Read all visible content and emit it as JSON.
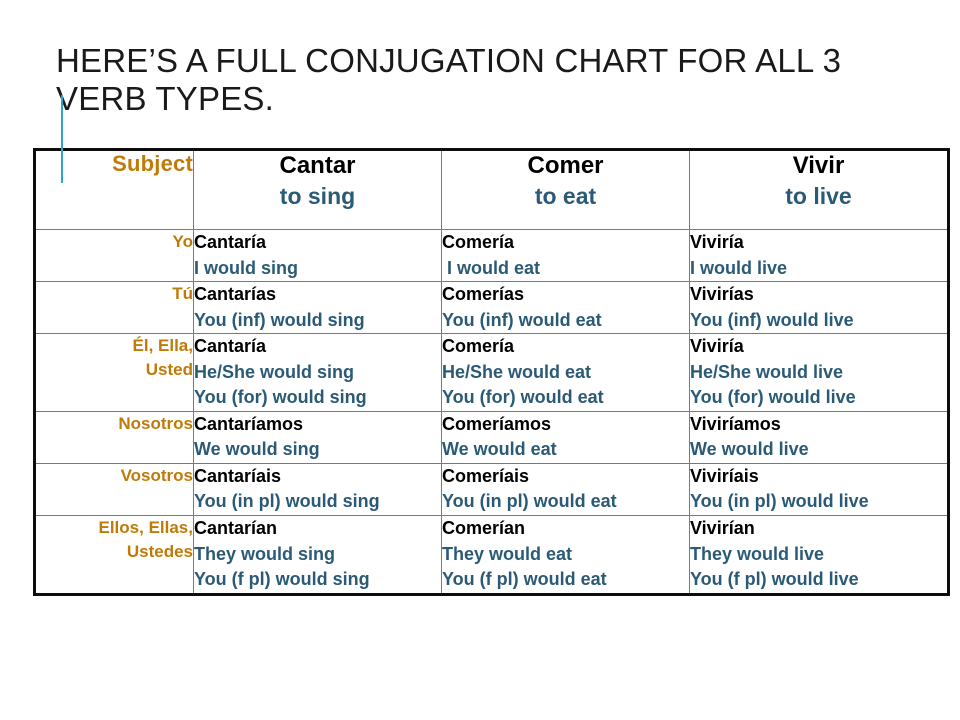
{
  "slide": {
    "title": "HERE’S A FULL CONJUGATION CHART FOR ALL 3 VERB TYPES.",
    "accent_line_color": "#2CA6CB",
    "subject_color": "#C07A08",
    "verb_color": "#000000",
    "translation_color": "#2B5A77",
    "table_border_color": "#0D0D0D",
    "grid_line_color": "#7A7A7A"
  },
  "table": {
    "headers": {
      "subject": "Subject",
      "columns": [
        {
          "verb": "Cantar",
          "gloss": "to sing"
        },
        {
          "verb": "Comer",
          "gloss": "to eat"
        },
        {
          "verb": "Vivir",
          "gloss": "to live"
        }
      ]
    },
    "rows": [
      {
        "subject_lines": [
          "Yo"
        ],
        "cells": [
          {
            "form": "Cantaría",
            "translations": [
              "I would sing"
            ]
          },
          {
            "form": "Comería",
            "translations": [
              " I would eat"
            ]
          },
          {
            "form": "Viviría",
            "translations": [
              "I would live"
            ]
          }
        ]
      },
      {
        "subject_lines": [
          "Tú"
        ],
        "cells": [
          {
            "form": "Cantarías",
            "translations": [
              "You (inf) would sing"
            ]
          },
          {
            "form": "Comerías",
            "translations": [
              "You (inf) would eat"
            ]
          },
          {
            "form": "Vivirías",
            "translations": [
              "You (inf) would live"
            ]
          }
        ]
      },
      {
        "subject_lines": [
          "Él, Ella,",
          "Usted"
        ],
        "cells": [
          {
            "form": "Cantaría",
            "translations": [
              "He/She would sing",
              "You (for) would sing"
            ]
          },
          {
            "form": "Comería",
            "translations": [
              "He/She would eat",
              "You (for) would eat"
            ]
          },
          {
            "form": "Viviría",
            "translations": [
              "He/She would live",
              "You (for) would live"
            ]
          }
        ]
      },
      {
        "subject_lines": [
          "Nosotros"
        ],
        "cells": [
          {
            "form": "Cantaríamos",
            "translations": [
              "We would sing"
            ]
          },
          {
            "form": "Comeríamos",
            "translations": [
              "We would eat"
            ]
          },
          {
            "form": "Viviríamos",
            "translations": [
              "We would live"
            ]
          }
        ]
      },
      {
        "subject_lines": [
          "Vosotros"
        ],
        "cells": [
          {
            "form": "Cantaríais",
            "translations": [
              "You (in pl) would sing"
            ]
          },
          {
            "form": "Comeríais",
            "translations": [
              "You (in pl) would eat"
            ]
          },
          {
            "form": "Viviríais",
            "translations": [
              "You (in pl) would live"
            ]
          }
        ]
      },
      {
        "subject_lines": [
          "Ellos, Ellas,",
          "Ustedes"
        ],
        "cells": [
          {
            "form": "Cantarían",
            "translations": [
              "They would sing",
              "You (f pl) would sing"
            ]
          },
          {
            "form": "Comerían",
            "translations": [
              "They would eat",
              "You (f pl) would eat"
            ]
          },
          {
            "form": "Vivirían",
            "translations": [
              "They would live",
              "You (f pl) would live"
            ]
          }
        ]
      }
    ]
  }
}
